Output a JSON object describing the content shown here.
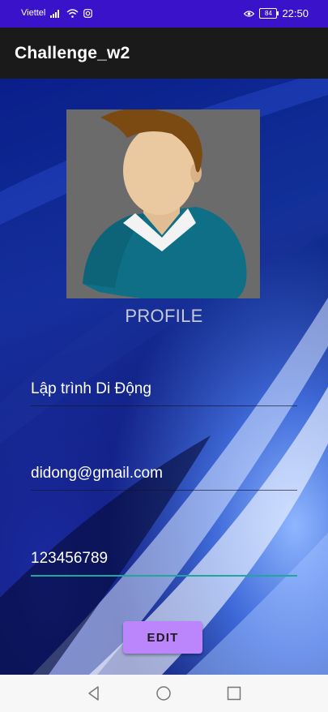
{
  "status_bar": {
    "carrier": "Viettel",
    "battery": "84",
    "time": "22:50",
    "icons": [
      "signal-icon",
      "wifi-icon",
      "instagram-icon",
      "eye-icon",
      "battery-icon"
    ]
  },
  "app_bar": {
    "title": "Challenge_w2"
  },
  "profile": {
    "label": "PROFILE"
  },
  "form": {
    "name_value": "Lập trình Di Động",
    "email_value": "didong@gmail.com",
    "phone_value": "123456789",
    "edit_label": "EDIT"
  },
  "colors": {
    "status_bar": "#3a12c9",
    "app_bar": "#1a1a1a",
    "button": "#bb86fc",
    "focus_underline": "#1ea79a"
  },
  "nav": {
    "icons": [
      "back-icon",
      "home-icon",
      "recents-icon"
    ]
  }
}
